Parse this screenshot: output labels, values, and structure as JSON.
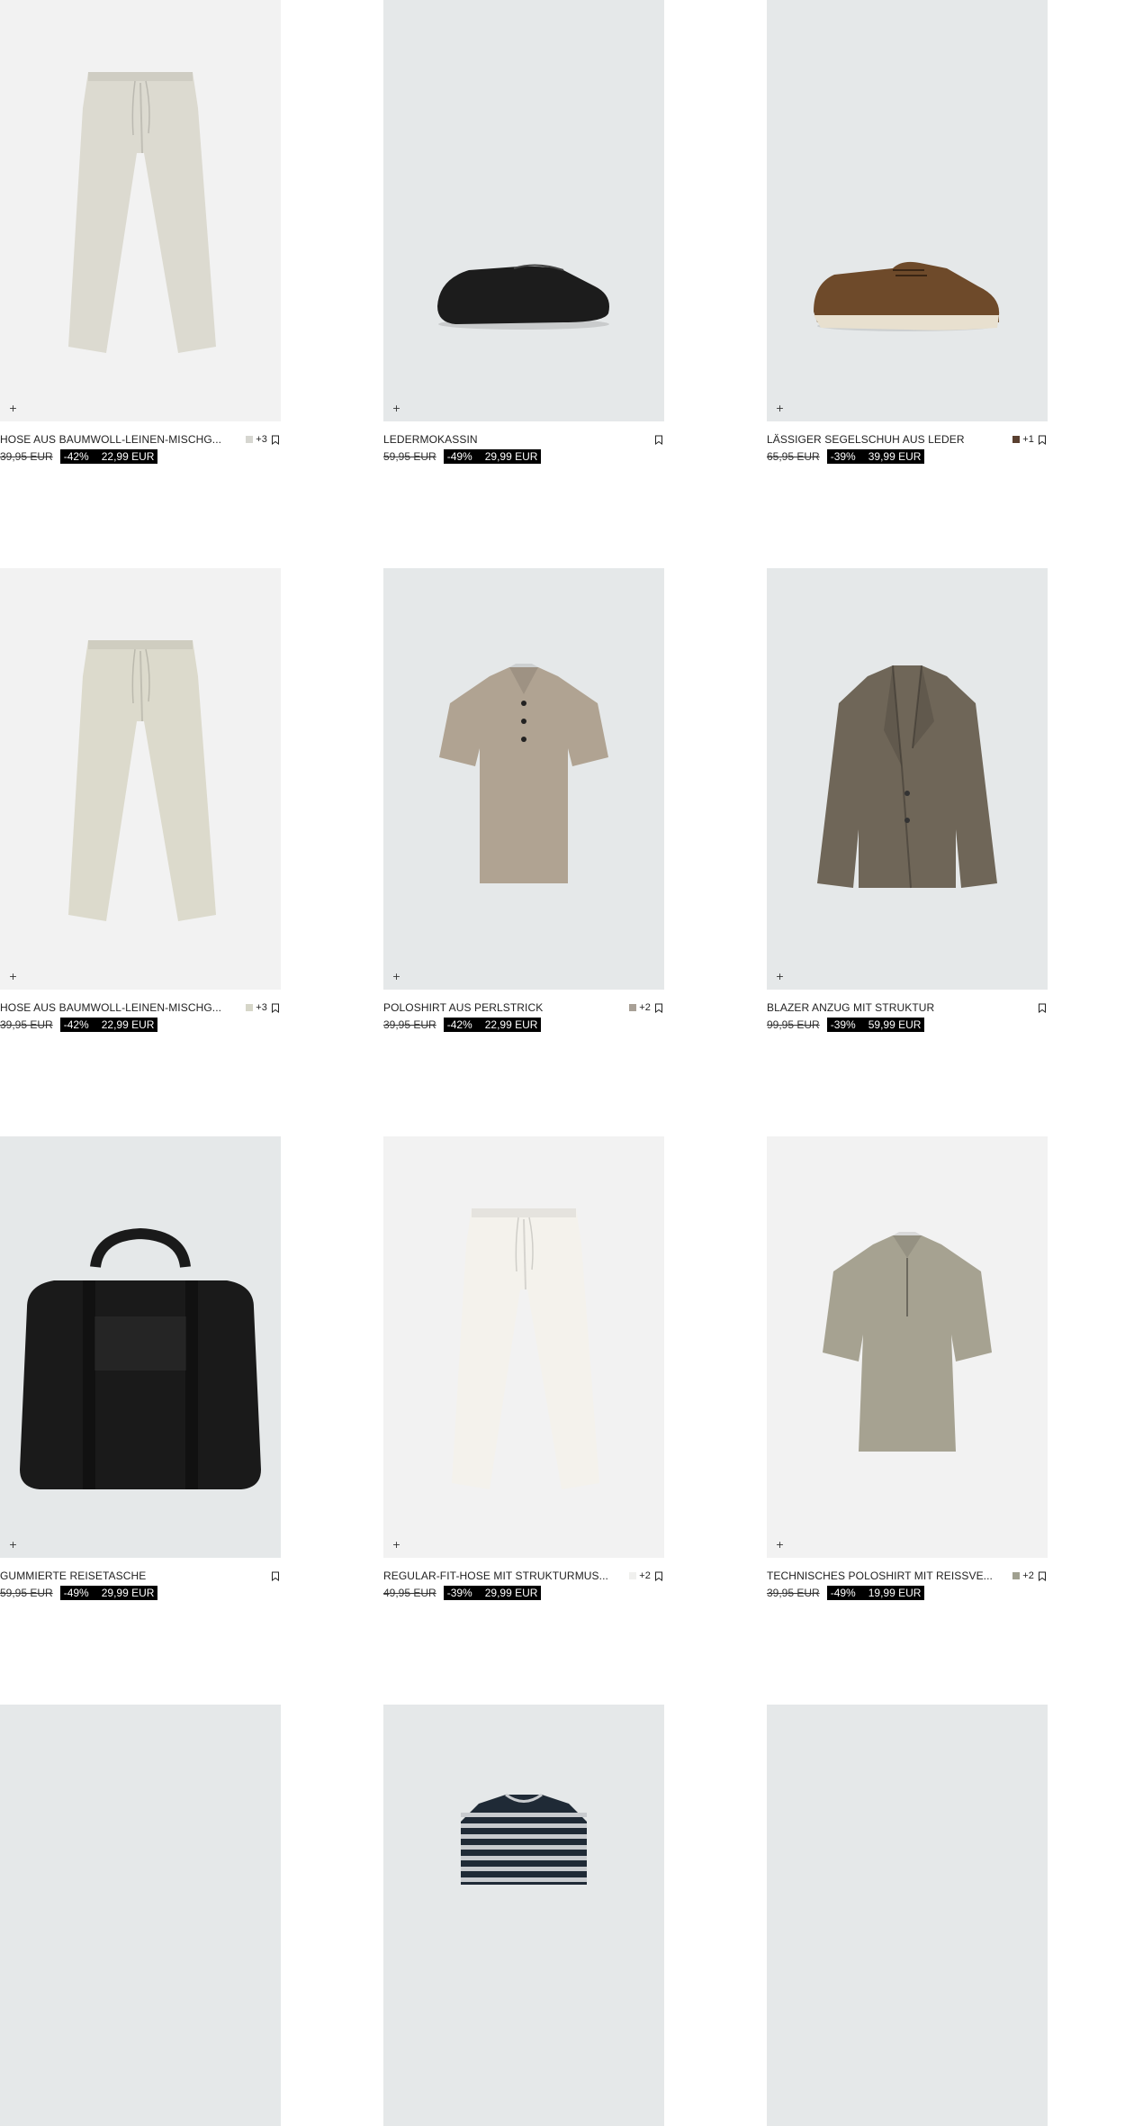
{
  "products": [
    {
      "title": "HOSE AUS BAUMWOLL-LEINEN-MISCHG...",
      "swatch": "#d6d6d0",
      "more": "+3",
      "old": "39,95 EUR",
      "disc": "-42%",
      "price": "22,99 EUR",
      "bg": "#f2f2f2",
      "art": "pants-icon",
      "color": "#dcdad0"
    },
    {
      "title": "LEDERMOKASSIN",
      "swatch": "",
      "more": "",
      "old": "59,95 EUR",
      "disc": "-49%",
      "price": "29,99 EUR",
      "bg": "#e5e8e9",
      "art": "loafer-icon",
      "color": "#1c1c1c"
    },
    {
      "title": "LÄSSIGER SEGELSCHUH AUS LEDER",
      "swatch": "#5a4030",
      "more": "+1",
      "old": "65,95 EUR",
      "disc": "-39%",
      "price": "39,99 EUR",
      "bg": "#e5e8e9",
      "art": "boat-shoe-icon",
      "color": "#6e4a2a"
    },
    {
      "title": "HOSE AUS BAUMWOLL-LEINEN-MISCHG...",
      "swatch": "#d6d6c8",
      "more": "+3",
      "old": "39,95 EUR",
      "disc": "-42%",
      "price": "22,99 EUR",
      "bg": "#f2f2f2",
      "art": "pants-icon",
      "color": "#dcdacc"
    },
    {
      "title": "POLOSHIRT AUS PERLSTRICK",
      "swatch": "#a8a096",
      "more": "+2",
      "old": "39,95 EUR",
      "disc": "-42%",
      "price": "22,99 EUR",
      "bg": "#e5e8e9",
      "art": "polo-icon",
      "color": "#b0a392"
    },
    {
      "title": "BLAZER ANZUG MIT STRUKTUR",
      "swatch": "",
      "more": "",
      "old": "99,95 EUR",
      "disc": "-39%",
      "price": "59,99 EUR",
      "bg": "#e5e8e9",
      "art": "blazer-icon",
      "color": "#6f6658"
    },
    {
      "title": "GUMMIERTE REISETASCHE",
      "swatch": "",
      "more": "",
      "old": "59,95 EUR",
      "disc": "-49%",
      "price": "29,99 EUR",
      "bg": "#e5e8e9",
      "art": "bag-icon",
      "color": "#1a1a1a"
    },
    {
      "title": "REGULAR-FIT-HOSE MIT STRUKTURMUS...",
      "swatch": "#f0f0ee",
      "more": "+2",
      "old": "49,95 EUR",
      "disc": "-39%",
      "price": "29,99 EUR",
      "bg": "#f2f2f2",
      "art": "pants-icon",
      "color": "#f4f2ec"
    },
    {
      "title": "TECHNISCHES POLOSHIRT MIT REISSVE...",
      "swatch": "#a0a090",
      "more": "+2",
      "old": "39,95 EUR",
      "disc": "-49%",
      "price": "19,99 EUR",
      "bg": "#f2f2f2",
      "art": "zip-polo-icon",
      "color": "#a6a291"
    },
    {
      "title": "",
      "swatch": "",
      "more": "",
      "old": "",
      "disc": "",
      "price": "",
      "bg": "#e5e8e9",
      "art": "",
      "color": ""
    },
    {
      "title": "",
      "swatch": "",
      "more": "",
      "old": "",
      "disc": "",
      "price": "",
      "bg": "#e5e8e9",
      "art": "striped-sweater-icon",
      "color": "#1f2a36"
    },
    {
      "title": "",
      "swatch": "",
      "more": "",
      "old": "",
      "disc": "",
      "price": "",
      "bg": "#e5e8e9",
      "art": "",
      "color": ""
    }
  ],
  "quick_add_symbol": "+"
}
